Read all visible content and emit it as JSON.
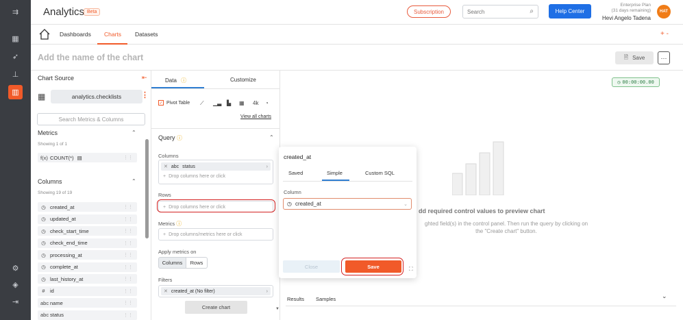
{
  "header": {
    "app_title": "Analytics",
    "beta_badge": "Beta",
    "subscription_label": "Subscription",
    "search_placeholder": "Search",
    "help_center_label": "Help Center",
    "plan_line1": "Enterprise Plan",
    "plan_line2": "(31 days remaining)",
    "user_name": "Hevi Angelo Tadena",
    "avatar_initials": "HAT"
  },
  "nav": {
    "tabs": [
      {
        "label": "Dashboards"
      },
      {
        "label": "Charts"
      },
      {
        "label": "Datasets"
      }
    ],
    "plus_label": "+ -"
  },
  "title_row": {
    "chart_name_placeholder": "Add the name of the chart",
    "save_label": "Save",
    "more_label": "···"
  },
  "left_panel": {
    "chart_source_title": "Chart Source",
    "source_name": "analytics.checklists",
    "search_placeholder": "Search Metrics & Columns",
    "metrics_title": "Metrics",
    "metrics_count": "Showing 1 of 1",
    "metrics": [
      {
        "icon": "f(x)",
        "label": "COUNT(*)"
      }
    ],
    "columns_title": "Columns",
    "columns_count": "Showing 19 of 19",
    "columns": [
      {
        "icon": "◷",
        "label": "created_at"
      },
      {
        "icon": "◷",
        "label": "updated_at"
      },
      {
        "icon": "◷",
        "label": "check_start_time"
      },
      {
        "icon": "◷",
        "label": "check_end_time"
      },
      {
        "icon": "◷",
        "label": "processing_at"
      },
      {
        "icon": "◷",
        "label": "complete_at"
      },
      {
        "icon": "◷",
        "label": "last_history_at"
      },
      {
        "icon": "#",
        "label": "id"
      },
      {
        "icon": "abc",
        "label": "name"
      },
      {
        "icon": "abc",
        "label": "status"
      }
    ]
  },
  "mid_panel": {
    "tab_data": "Data",
    "tab_customize": "Customize",
    "pivot_table_label": "Pivot Table",
    "chart_4k_label": "4k",
    "view_all_charts": "View all charts",
    "query_label": "Query",
    "columns_label": "Columns",
    "columns_chip": {
      "type": "abc",
      "label": "status"
    },
    "drop_columns_hint": "Drop columns here or click",
    "rows_label": "Rows",
    "drop_rows_hint": "Drop columns here or click",
    "metrics_label": "Metrics",
    "drop_metrics_hint": "Drop columns/metrics here or click",
    "apply_metrics_label": "Apply metrics on",
    "apply_columns": "Columns",
    "apply_rows": "Rows",
    "filters_label": "Filters",
    "filter_chip": "created_at (No filter)",
    "create_chart_label": "Create chart"
  },
  "right_panel": {
    "timer": "00:00:00.00",
    "placeholder_title": "dd required control values to preview chart",
    "placeholder_text_1": "ghted field(s) in the control panel. Then run the query by clicking on",
    "placeholder_text_2": "the \"Create chart\" button.",
    "results_tab": "Results",
    "samples_tab": "Samples"
  },
  "popover": {
    "title": "created_at",
    "tabs": [
      {
        "label": "Saved"
      },
      {
        "label": "Simple"
      },
      {
        "label": "Custom SQL"
      }
    ],
    "column_label": "Column",
    "column_value": "created_at",
    "close_label": "Close",
    "save_label": "Save"
  }
}
